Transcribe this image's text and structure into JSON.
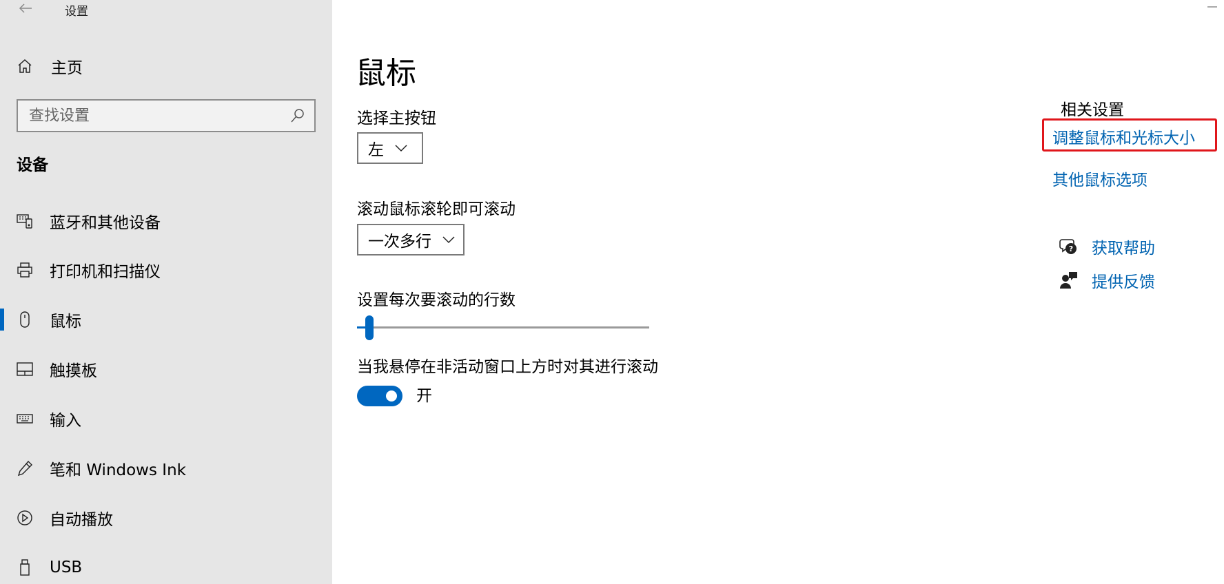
{
  "window": {
    "title": "设置"
  },
  "sidebar": {
    "home_label": "主页",
    "search": {
      "placeholder": "查找设置"
    },
    "section_title": "设备",
    "items": [
      {
        "label": "蓝牙和其他设备",
        "icon": "bluetooth-devices-icon"
      },
      {
        "label": "打印机和扫描仪",
        "icon": "printer-icon"
      },
      {
        "label": "鼠标",
        "icon": "mouse-icon",
        "selected": true
      },
      {
        "label": "触摸板",
        "icon": "touchpad-icon"
      },
      {
        "label": "输入",
        "icon": "keyboard-icon"
      },
      {
        "label": "笔和 Windows Ink",
        "icon": "pen-icon"
      },
      {
        "label": "自动播放",
        "icon": "autoplay-icon"
      },
      {
        "label": "USB",
        "icon": "usb-icon"
      }
    ]
  },
  "main": {
    "title": "鼠标",
    "primary_button": {
      "label": "选择主按钮",
      "value": "左"
    },
    "scroll_mode": {
      "label": "滚动鼠标滚轮即可滚动",
      "value": "一次多行"
    },
    "scroll_lines": {
      "label": "设置每次要滚动的行数",
      "level": 0.03
    },
    "inactive_scroll": {
      "label": "当我悬停在非活动窗口上方时对其进行滚动",
      "state_label": "开",
      "on": true
    }
  },
  "related": {
    "title": "相关设置",
    "links": [
      {
        "label": "调整鼠标和光标大小"
      },
      {
        "label": "其他鼠标选项"
      }
    ]
  },
  "help": {
    "get_help": "获取帮助",
    "feedback": "提供反馈"
  },
  "colors": {
    "accent": "#0067c0",
    "link": "#0063b1",
    "highlight": "#e0161b",
    "sidebar_bg": "#e6e6e6"
  }
}
